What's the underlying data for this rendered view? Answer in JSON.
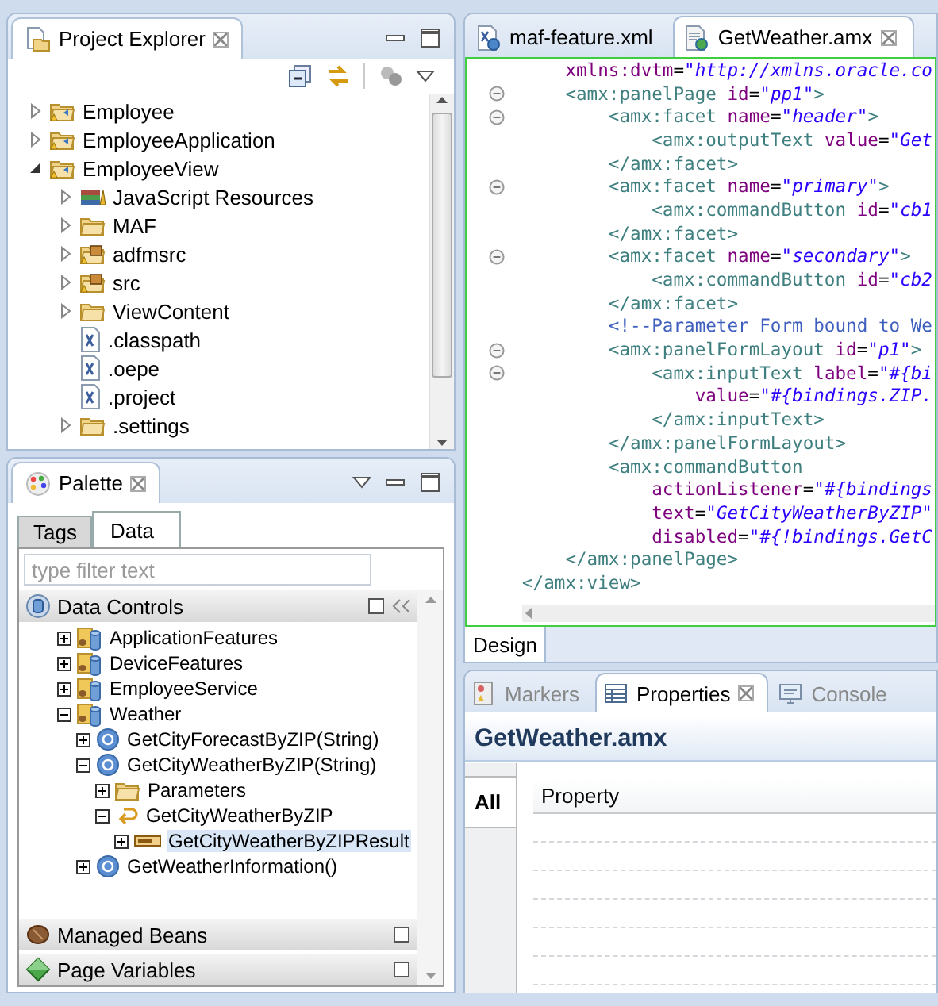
{
  "project_explorer": {
    "title": "Project Explorer",
    "tree": [
      {
        "label": "Employee",
        "kind": "project",
        "expanded": false
      },
      {
        "label": "EmployeeApplication",
        "kind": "project",
        "expanded": false
      },
      {
        "label": "EmployeeView",
        "kind": "project",
        "expanded": true,
        "children": [
          {
            "label": "JavaScript Resources",
            "kind": "library",
            "expanded": false
          },
          {
            "label": "MAF",
            "kind": "folder",
            "expanded": false
          },
          {
            "label": "adfmsrc",
            "kind": "package",
            "expanded": false
          },
          {
            "label": "src",
            "kind": "package",
            "expanded": false
          },
          {
            "label": "ViewContent",
            "kind": "folder",
            "expanded": false
          },
          {
            "label": ".classpath",
            "kind": "file"
          },
          {
            "label": ".oepe",
            "kind": "file"
          },
          {
            "label": ".project",
            "kind": "file"
          },
          {
            "label": ".settings",
            "kind": "folder",
            "expanded": false
          }
        ]
      }
    ]
  },
  "palette": {
    "title": "Palette",
    "tabs": [
      {
        "label": "Tags",
        "selected": false
      },
      {
        "label": "Data",
        "selected": true
      }
    ],
    "filter": {
      "placeholder": "type filter text"
    },
    "data_controls": {
      "title": "Data Controls",
      "tree": [
        {
          "label": "ApplicationFeatures",
          "kind": "data-control",
          "expanded": false,
          "selected": false
        },
        {
          "label": "DeviceFeatures",
          "kind": "data-control",
          "expanded": false,
          "selected": false
        },
        {
          "label": "EmployeeService",
          "kind": "data-control",
          "expanded": false,
          "selected": false
        },
        {
          "label": "Weather",
          "kind": "data-control",
          "expanded": true,
          "selected": false,
          "children": [
            {
              "label": "GetCityForecastByZIP(String)",
              "kind": "method",
              "expanded": false,
              "selected": false
            },
            {
              "label": "GetCityWeatherByZIP(String)",
              "kind": "method",
              "expanded": true,
              "selected": false,
              "children": [
                {
                  "label": "Parameters",
                  "kind": "folder",
                  "expanded": false,
                  "selected": false
                },
                {
                  "label": "GetCityWeatherByZIP",
                  "kind": "return",
                  "expanded": true,
                  "selected": false,
                  "children": [
                    {
                      "label": "GetCityWeatherByZIPResult",
                      "kind": "attribute",
                      "expanded": false,
                      "selected": true
                    }
                  ]
                }
              ]
            },
            {
              "label": "GetWeatherInformation()",
              "kind": "method",
              "expanded": false,
              "selected": false
            }
          ]
        }
      ]
    },
    "sections": [
      {
        "title": "Managed Beans",
        "kind": "beans"
      },
      {
        "title": "Page Variables",
        "kind": "variables"
      }
    ]
  },
  "editor": {
    "tabs": [
      {
        "label": "maf-feature.xml",
        "kind": "xml",
        "selected": false
      },
      {
        "label": "GetWeather.amx",
        "kind": "amx",
        "selected": true
      }
    ],
    "lines": [
      {
        "fold": false,
        "tokens": [
          {
            "kind": "attr",
            "text": "    xmlns:dvtm"
          },
          {
            "kind": "punct",
            "text": "="
          },
          {
            "kind": "value",
            "text": "\"http://xmlns.oracle.co"
          }
        ]
      },
      {
        "fold": true,
        "tokens": [
          {
            "kind": "tag",
            "text": "    <amx:panelPage"
          },
          {
            "kind": "attr",
            "text": " id"
          },
          {
            "kind": "punct",
            "text": "="
          },
          {
            "kind": "value",
            "text": "\"pp1\""
          },
          {
            "kind": "tag",
            "text": ">"
          }
        ]
      },
      {
        "fold": true,
        "tokens": [
          {
            "kind": "tag",
            "text": "        <amx:facet"
          },
          {
            "kind": "attr",
            "text": " name"
          },
          {
            "kind": "punct",
            "text": "="
          },
          {
            "kind": "value",
            "text": "\"header\""
          },
          {
            "kind": "tag",
            "text": ">"
          }
        ]
      },
      {
        "fold": false,
        "tokens": [
          {
            "kind": "tag",
            "text": "            <amx:outputText"
          },
          {
            "kind": "attr",
            "text": " value"
          },
          {
            "kind": "punct",
            "text": "="
          },
          {
            "kind": "value",
            "text": "\"Get"
          }
        ]
      },
      {
        "fold": false,
        "tokens": [
          {
            "kind": "tag",
            "text": "        </amx:facet>"
          }
        ]
      },
      {
        "fold": true,
        "tokens": [
          {
            "kind": "tag",
            "text": "        <amx:facet"
          },
          {
            "kind": "attr",
            "text": " name"
          },
          {
            "kind": "punct",
            "text": "="
          },
          {
            "kind": "value",
            "text": "\"primary\""
          },
          {
            "kind": "tag",
            "text": ">"
          }
        ]
      },
      {
        "fold": false,
        "tokens": [
          {
            "kind": "tag",
            "text": "            <amx:commandButton"
          },
          {
            "kind": "attr",
            "text": " id"
          },
          {
            "kind": "punct",
            "text": "="
          },
          {
            "kind": "value",
            "text": "\"cb1"
          }
        ]
      },
      {
        "fold": false,
        "tokens": [
          {
            "kind": "tag",
            "text": "        </amx:facet>"
          }
        ]
      },
      {
        "fold": true,
        "tokens": [
          {
            "kind": "tag",
            "text": "        <amx:facet"
          },
          {
            "kind": "attr",
            "text": " name"
          },
          {
            "kind": "punct",
            "text": "="
          },
          {
            "kind": "value",
            "text": "\"secondary\""
          },
          {
            "kind": "tag",
            "text": ">"
          }
        ]
      },
      {
        "fold": false,
        "tokens": [
          {
            "kind": "tag",
            "text": "            <amx:commandButton"
          },
          {
            "kind": "attr",
            "text": " id"
          },
          {
            "kind": "punct",
            "text": "="
          },
          {
            "kind": "value",
            "text": "\"cb2"
          }
        ]
      },
      {
        "fold": false,
        "tokens": [
          {
            "kind": "tag",
            "text": "        </amx:facet>"
          }
        ]
      },
      {
        "fold": false,
        "tokens": [
          {
            "kind": "comment",
            "text": "        <!--Parameter Form bound to We"
          }
        ]
      },
      {
        "fold": true,
        "tokens": [
          {
            "kind": "tag",
            "text": "        <amx:panelFormLayout"
          },
          {
            "kind": "attr",
            "text": " id"
          },
          {
            "kind": "punct",
            "text": "="
          },
          {
            "kind": "value",
            "text": "\"p1\""
          },
          {
            "kind": "tag",
            "text": ">"
          }
        ]
      },
      {
        "fold": true,
        "tokens": [
          {
            "kind": "tag",
            "text": "            <amx:inputText"
          },
          {
            "kind": "attr",
            "text": " label"
          },
          {
            "kind": "punct",
            "text": "="
          },
          {
            "kind": "value",
            "text": "\"#{bi"
          }
        ]
      },
      {
        "fold": false,
        "tokens": [
          {
            "kind": "attr",
            "text": "                value"
          },
          {
            "kind": "punct",
            "text": "="
          },
          {
            "kind": "value",
            "text": "\"#{bindings.ZIP."
          }
        ]
      },
      {
        "fold": false,
        "tokens": [
          {
            "kind": "tag",
            "text": "            </amx:inputText>"
          }
        ]
      },
      {
        "fold": false,
        "tokens": [
          {
            "kind": "tag",
            "text": "        </amx:panelFormLayout>"
          }
        ]
      },
      {
        "fold": false,
        "tokens": [
          {
            "kind": "tag",
            "text": "        <amx:commandButton"
          }
        ]
      },
      {
        "fold": false,
        "tokens": [
          {
            "kind": "attr",
            "text": "            actionListener"
          },
          {
            "kind": "punct",
            "text": "="
          },
          {
            "kind": "value",
            "text": "\"#{bindings"
          }
        ]
      },
      {
        "fold": false,
        "tokens": [
          {
            "kind": "attr",
            "text": "            text"
          },
          {
            "kind": "punct",
            "text": "="
          },
          {
            "kind": "value",
            "text": "\"GetCityWeatherByZIP\""
          }
        ]
      },
      {
        "fold": false,
        "tokens": [
          {
            "kind": "attr",
            "text": "            disabled"
          },
          {
            "kind": "punct",
            "text": "="
          },
          {
            "kind": "value",
            "text": "\"#{!bindings.GetC"
          }
        ]
      },
      {
        "fold": false,
        "tokens": [
          {
            "kind": "tag",
            "text": "    </amx:panelPage>"
          }
        ]
      },
      {
        "fold": false,
        "tokens": [
          {
            "kind": "tag",
            "text": "</amx:view>"
          }
        ]
      }
    ],
    "bottom_tabs": [
      {
        "label": "Design",
        "selected": true
      }
    ]
  },
  "properties": {
    "tabs": [
      {
        "label": "Markers",
        "kind": "markers",
        "selected": false
      },
      {
        "label": "Properties",
        "kind": "properties",
        "selected": true
      },
      {
        "label": "Console",
        "kind": "console",
        "selected": false
      }
    ],
    "title": "GetWeather.amx",
    "side_tabs": [
      {
        "label": "All",
        "selected": true
      }
    ],
    "columns": [
      "Property"
    ]
  }
}
